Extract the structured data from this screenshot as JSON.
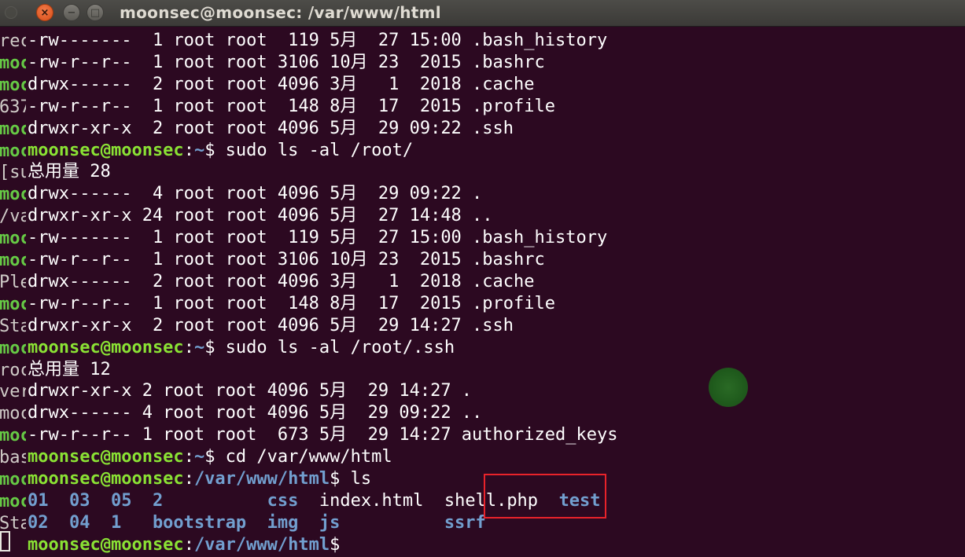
{
  "window": {
    "title": "moonsec@moonsec: /var/www/html",
    "close_glyph": "×",
    "min_glyph": "−",
    "max_glyph": "□"
  },
  "colors": {
    "background": "#2c0921",
    "prompt_user": "#8ae234",
    "prompt_path": "#729fcf",
    "directory": "#729fcf",
    "highlight_box": "#e8232a"
  },
  "terminal": {
    "left_edge": [
      {
        "text": "rec",
        "style": "w"
      },
      {
        "text": "moc",
        "style": "g"
      },
      {
        "text": "moc",
        "style": "g"
      },
      {
        "text": "637",
        "style": "w"
      },
      {
        "text": "moc",
        "style": "g"
      },
      {
        "text": "moc",
        "style": "g"
      },
      {
        "text": "[su",
        "style": "w"
      },
      {
        "text": "moc",
        "style": "g"
      },
      {
        "text": "/va",
        "style": "w"
      },
      {
        "text": "moc",
        "style": "g"
      },
      {
        "text": "moc",
        "style": "g"
      },
      {
        "text": "Ple",
        "style": "w"
      },
      {
        "text": "moc",
        "style": "g"
      },
      {
        "text": "Sta",
        "style": "w"
      },
      {
        "text": "moc",
        "style": "g"
      },
      {
        "text": "roc",
        "style": "w"
      },
      {
        "text": "ver",
        "style": "w"
      },
      {
        "text": "moc",
        "style": "w"
      },
      {
        "text": "moc",
        "style": "g"
      },
      {
        "text": "bas",
        "style": "w"
      },
      {
        "text": "moc",
        "style": "g"
      },
      {
        "text": "moc",
        "style": "g"
      },
      {
        "text": "Sta",
        "style": "w"
      },
      {
        "text": "",
        "style": "w"
      }
    ],
    "lines": [
      [
        {
          "t": "-rw-------  1 root root  119 5月  27 15:00 .bash_history",
          "c": "w"
        }
      ],
      [
        {
          "t": "-rw-r--r--  1 root root 3106 10月 23  2015 .bashrc",
          "c": "w"
        }
      ],
      [
        {
          "t": "drwx------  2 root root 4096 3月   1  2018 .cache",
          "c": "w"
        }
      ],
      [
        {
          "t": "-rw-r--r--  1 root root  148 8月  17  2015 .profile",
          "c": "w"
        }
      ],
      [
        {
          "t": "drwxr-xr-x  2 root root 4096 5月  29 09:22 .ssh",
          "c": "w"
        }
      ],
      [
        {
          "t": "moonsec@moonsec",
          "c": "g"
        },
        {
          "t": ":",
          "c": "w"
        },
        {
          "t": "~",
          "c": "b"
        },
        {
          "t": "$ sudo ls -al /root/",
          "c": "w"
        }
      ],
      [
        {
          "t": "总用量 28",
          "c": "w"
        }
      ],
      [
        {
          "t": "drwx------  4 root root 4096 5月  29 09:22 .",
          "c": "w"
        }
      ],
      [
        {
          "t": "drwxr-xr-x 24 root root 4096 5月  27 14:48 ..",
          "c": "w"
        }
      ],
      [
        {
          "t": "-rw-------  1 root root  119 5月  27 15:00 .bash_history",
          "c": "w"
        }
      ],
      [
        {
          "t": "-rw-r--r--  1 root root 3106 10月 23  2015 .bashrc",
          "c": "w"
        }
      ],
      [
        {
          "t": "drwx------  2 root root 4096 3月   1  2018 .cache",
          "c": "w"
        }
      ],
      [
        {
          "t": "-rw-r--r--  1 root root  148 8月  17  2015 .profile",
          "c": "w"
        }
      ],
      [
        {
          "t": "drwxr-xr-x  2 root root 4096 5月  29 14:27 .ssh",
          "c": "w"
        }
      ],
      [
        {
          "t": "moonsec@moonsec",
          "c": "g"
        },
        {
          "t": ":",
          "c": "w"
        },
        {
          "t": "~",
          "c": "b"
        },
        {
          "t": "$ sudo ls -al /root/.ssh",
          "c": "w"
        }
      ],
      [
        {
          "t": "总用量 12",
          "c": "w"
        }
      ],
      [
        {
          "t": "drwxr-xr-x 2 root root 4096 5月  29 14:27 .",
          "c": "w"
        }
      ],
      [
        {
          "t": "drwx------ 4 root root 4096 5月  29 09:22 ..",
          "c": "w"
        }
      ],
      [
        {
          "t": "-rw-r--r-- 1 root root  673 5月  29 14:27 authorized_keys",
          "c": "w"
        }
      ],
      [
        {
          "t": "moonsec@moonsec",
          "c": "g"
        },
        {
          "t": ":",
          "c": "w"
        },
        {
          "t": "~",
          "c": "b"
        },
        {
          "t": "$ cd /var/www/html",
          "c": "w"
        }
      ],
      [
        {
          "t": "moonsec@moonsec",
          "c": "g"
        },
        {
          "t": ":",
          "c": "w"
        },
        {
          "t": "/var/www/html",
          "c": "b"
        },
        {
          "t": "$ ls",
          "c": "w"
        }
      ],
      [
        {
          "t": "01  03  05  2",
          "c": "b"
        },
        {
          "t": "          ",
          "c": "w"
        },
        {
          "t": "css",
          "c": "b"
        },
        {
          "t": "  ",
          "c": "w"
        },
        {
          "t": "index.html",
          "c": "w"
        },
        {
          "t": "  ",
          "c": "w"
        },
        {
          "t": "shell.php",
          "c": "w"
        },
        {
          "t": "  ",
          "c": "w"
        },
        {
          "t": "test",
          "c": "b"
        }
      ],
      [
        {
          "t": "02  04  1   bootstrap  img  js",
          "c": "b"
        },
        {
          "t": "          ",
          "c": "w"
        },
        {
          "t": "ssrf",
          "c": "b"
        }
      ],
      [
        {
          "t": "moonsec@moonsec",
          "c": "g"
        },
        {
          "t": ":",
          "c": "w"
        },
        {
          "t": "/var/www/html",
          "c": "b"
        },
        {
          "t": "$",
          "c": "w"
        }
      ]
    ]
  }
}
